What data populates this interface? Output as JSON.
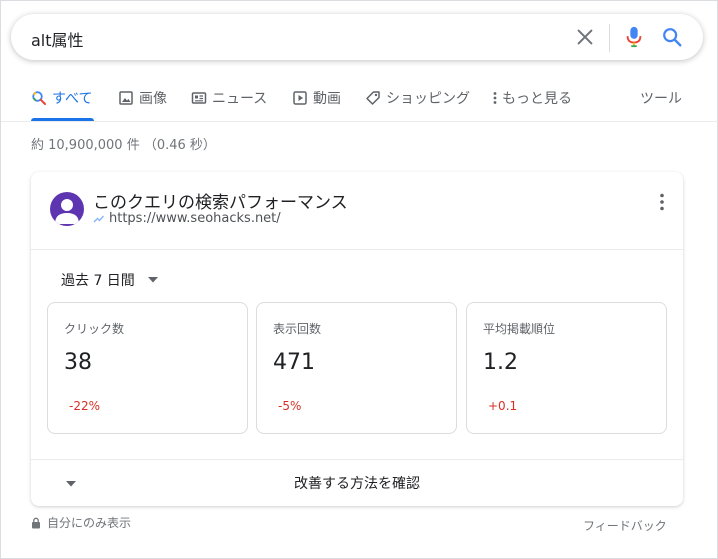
{
  "search": {
    "query": "alt属性"
  },
  "tabs": [
    {
      "label": "すべて",
      "icon": "search-icon",
      "active": true
    },
    {
      "label": "画像",
      "icon": "image-icon"
    },
    {
      "label": "ニュース",
      "icon": "news-icon"
    },
    {
      "label": "動画",
      "icon": "video-icon"
    },
    {
      "label": "ショッピング",
      "icon": "tag-icon"
    },
    {
      "label": "もっと見る",
      "icon": "more-vert-icon"
    },
    {
      "label": "ツール"
    }
  ],
  "result_stats": "約 10,900,000 件 （0.46 秒）",
  "card": {
    "title": "このクエリの検索パフォーマンス",
    "url": "https://www.seohacks.net/",
    "period": "過去 7 日間",
    "metrics": [
      {
        "label": "クリック数",
        "value": "38",
        "delta": "-22%"
      },
      {
        "label": "表示回数",
        "value": "471",
        "delta": "-5%"
      },
      {
        "label": "平均掲載順位",
        "value": "1.2",
        "delta": "+0.1"
      }
    ],
    "improve_label": "改善する方法を確認"
  },
  "footer": {
    "private_label": "自分にのみ表示",
    "feedback_label": "フィードバック"
  },
  "colors": {
    "accent": "#1a73e8",
    "negative": "#d93025",
    "avatar": "#5e35b1"
  }
}
